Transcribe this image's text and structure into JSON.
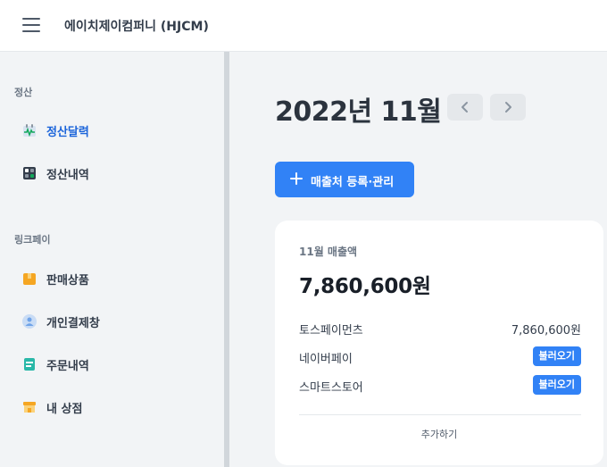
{
  "header": {
    "company_name": "에이치제이컴퍼니 (HJCM)",
    "menu_icon": "hamburger-icon"
  },
  "sidebar": {
    "sections": [
      {
        "title": "정산",
        "items": [
          {
            "label": "정산달력",
            "icon": "calendar-chart-icon",
            "active": true
          },
          {
            "label": "정산내역",
            "icon": "calculator-icon",
            "active": false
          }
        ]
      },
      {
        "title": "링크페이",
        "items": [
          {
            "label": "판매상품",
            "icon": "box-icon",
            "active": false
          },
          {
            "label": "개인결제창",
            "icon": "person-icon",
            "active": false
          },
          {
            "label": "주문내역",
            "icon": "document-icon",
            "active": false
          },
          {
            "label": "내 상점",
            "icon": "store-icon",
            "active": false
          }
        ]
      }
    ],
    "accent_color": "#1b64da"
  },
  "main": {
    "month_title": "2022년 11월",
    "prev_icon": "chevron-left-icon",
    "next_icon": "chevron-right-icon",
    "register_button": "매출처 등록·관리",
    "primary_color": "#3182f6",
    "sales_card": {
      "label": "11월 매출액",
      "total": "7,860,600원",
      "rows": [
        {
          "name": "토스페이먼츠",
          "value": "7,860,600원"
        },
        {
          "name": "네이버페이",
          "action": "불러오기"
        },
        {
          "name": "스마트스토어",
          "action": "불러오기"
        }
      ],
      "add_label": "추가하기"
    }
  }
}
